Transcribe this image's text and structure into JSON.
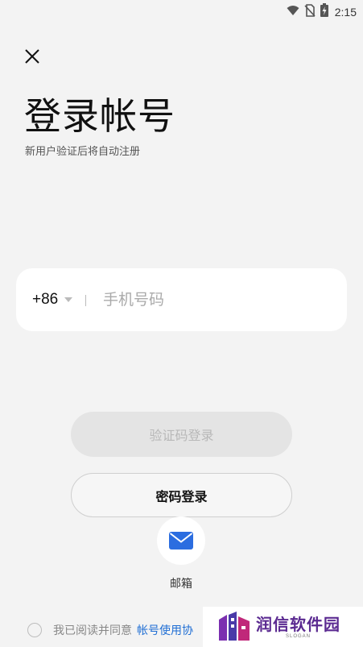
{
  "status_bar": {
    "time": "2:15",
    "icons": [
      "wifi-icon",
      "no-sim-icon",
      "battery-charging-icon"
    ]
  },
  "header": {
    "close_icon": "close-icon",
    "title": "登录帐号",
    "subtitle": "新用户验证后将自动注册"
  },
  "phone_form": {
    "country_code": "+86",
    "dropdown_icon": "caret-down-icon",
    "phone_placeholder": "手机号码",
    "phone_value": ""
  },
  "actions": {
    "code_login_label": "验证码登录",
    "password_login_label": "密码登录"
  },
  "alt_login": {
    "email_icon": "mail-icon",
    "email_label": "邮箱",
    "accent_color": "#2b6de0"
  },
  "agreement": {
    "text": "我已阅读并同意",
    "link_text": "帐号使用协",
    "checked": false
  },
  "watermark": {
    "name": "润信软件园",
    "slogan": "SLOGAN"
  },
  "colors": {
    "background": "#f3f3f3",
    "link": "#1f6ed4",
    "disabled_button": "#e4e4e4",
    "watermark_brand": "#5b2a91"
  }
}
